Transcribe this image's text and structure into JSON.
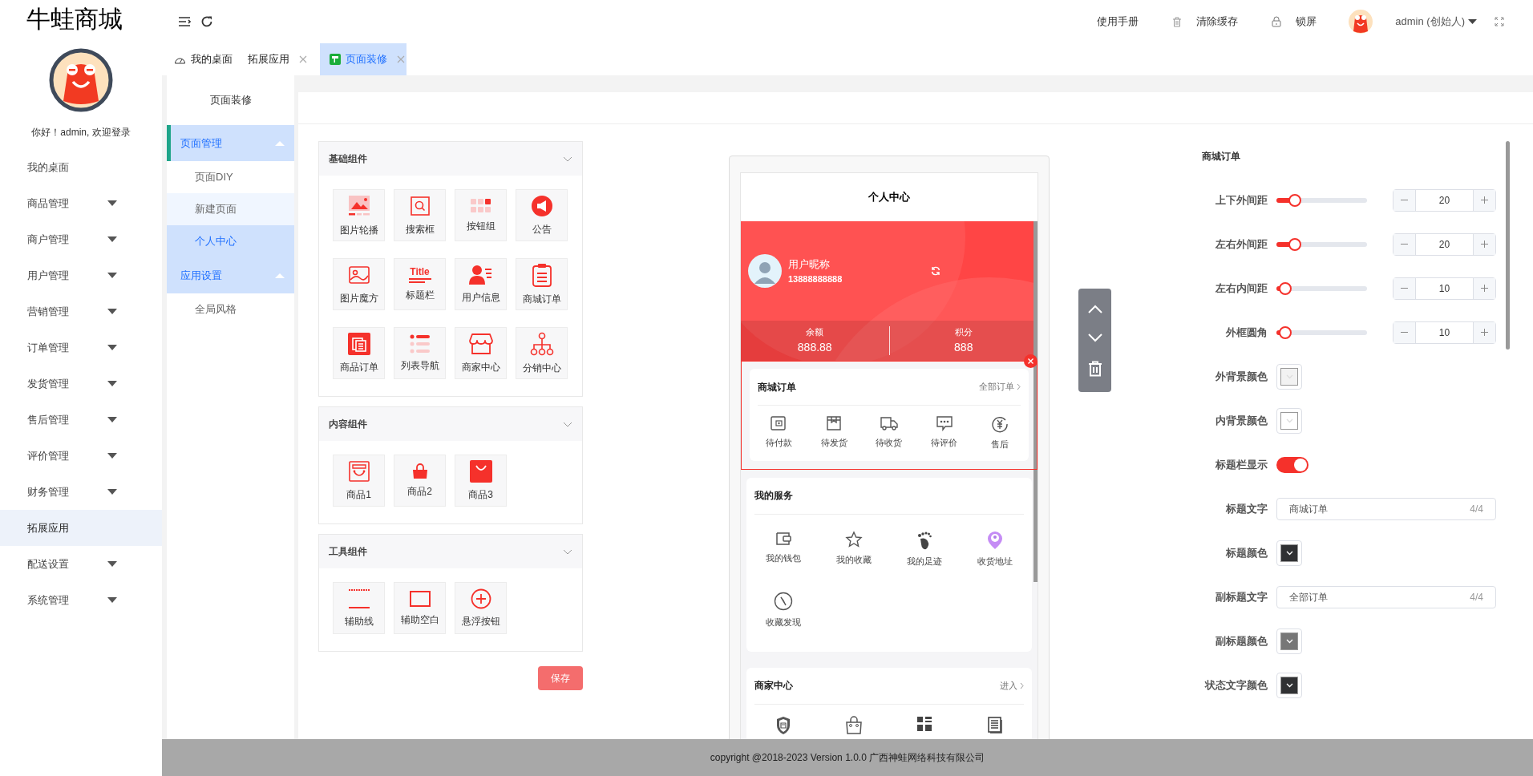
{
  "brand": "牛蛙商城",
  "greeting": "你好！admin, 欢迎登录",
  "side_menu": [
    {
      "label": "我的桌面",
      "expandable": false,
      "selected": false
    },
    {
      "label": "商品管理",
      "expandable": true,
      "selected": false
    },
    {
      "label": "商户管理",
      "expandable": true,
      "selected": false
    },
    {
      "label": "用户管理",
      "expandable": true,
      "selected": false
    },
    {
      "label": "营销管理",
      "expandable": true,
      "selected": false
    },
    {
      "label": "订单管理",
      "expandable": true,
      "selected": false
    },
    {
      "label": "发货管理",
      "expandable": true,
      "selected": false
    },
    {
      "label": "售后管理",
      "expandable": true,
      "selected": false
    },
    {
      "label": "评价管理",
      "expandable": true,
      "selected": false
    },
    {
      "label": "财务管理",
      "expandable": true,
      "selected": false
    },
    {
      "label": "拓展应用",
      "expandable": false,
      "selected": true
    },
    {
      "label": "配送设置",
      "expandable": true,
      "selected": false
    },
    {
      "label": "系统管理",
      "expandable": true,
      "selected": false
    }
  ],
  "header": {
    "actions": [
      {
        "label": "使用手册"
      },
      {
        "label": "清除缓存"
      },
      {
        "label": "锁屏"
      }
    ],
    "user": "admin (创始人)"
  },
  "tabs": [
    {
      "label": "我的桌面",
      "closable": false,
      "selected": false
    },
    {
      "label": "拓展应用",
      "closable": true,
      "selected": false
    },
    {
      "label": "页面装修",
      "closable": true,
      "selected": true
    }
  ],
  "sub_menu": {
    "title": "页面装修",
    "groups": [
      {
        "label": "页面管理",
        "expanded": true,
        "active": true,
        "children": [
          {
            "label": "页面DIY",
            "selected": false,
            "hovered": false
          },
          {
            "label": "新建页面",
            "selected": false,
            "hovered": true
          },
          {
            "label": "个人中心",
            "selected": true,
            "hovered": false
          }
        ]
      },
      {
        "label": "应用设置",
        "expanded": true,
        "active": false,
        "children": [
          {
            "label": "全局风格",
            "selected": false,
            "hovered": false
          }
        ]
      }
    ]
  },
  "component_groups": [
    {
      "title": "基础组件",
      "expanded": true,
      "items": [
        {
          "label": "图片轮播"
        },
        {
          "label": "搜索框"
        },
        {
          "label": "按钮组"
        },
        {
          "label": "公告"
        },
        {
          "label": "图片魔方"
        },
        {
          "label": "标题栏",
          "icon_text": "Title"
        },
        {
          "label": "用户信息"
        },
        {
          "label": "商城订单"
        },
        {
          "label": "商品订单"
        },
        {
          "label": "列表导航"
        },
        {
          "label": "商家中心"
        },
        {
          "label": "分销中心"
        }
      ]
    },
    {
      "title": "内容组件",
      "expanded": true,
      "items": [
        {
          "label": "商品1"
        },
        {
          "label": "商品2"
        },
        {
          "label": "商品3"
        }
      ]
    },
    {
      "title": "工具组件",
      "expanded": true,
      "items": [
        {
          "label": "辅助线"
        },
        {
          "label": "辅助空白"
        },
        {
          "label": "悬浮按钮"
        }
      ]
    }
  ],
  "save_button": "保存",
  "phone": {
    "title": "个人中心",
    "user": {
      "nickname": "用户昵称",
      "phone": "13888888888"
    },
    "stats": [
      {
        "label": "余额",
        "value": "888.88"
      },
      {
        "label": "积分",
        "value": "888"
      }
    ],
    "cards": [
      {
        "title": "商城订单",
        "more": "全部订单",
        "selected": true,
        "items": [
          "待付款",
          "待发货",
          "待收货",
          "待评价",
          "售后"
        ]
      },
      {
        "title": "我的服务",
        "selected": false,
        "items": [
          "我的钱包",
          "我的收藏",
          "我的足迹",
          "收货地址",
          "收藏发现"
        ]
      },
      {
        "title": "商家中心",
        "more": "进入",
        "selected": false
      }
    ]
  },
  "settings": {
    "title": "商城订单",
    "rows": [
      {
        "kind": "slider",
        "label": "上下外间距",
        "level": 0.2,
        "value": "20"
      },
      {
        "kind": "slider",
        "label": "左右外间距",
        "level": 0.2,
        "value": "20"
      },
      {
        "kind": "slider",
        "label": "左右内间距",
        "level": 0.1,
        "value": "10"
      },
      {
        "kind": "slider",
        "label": "外框圆角",
        "level": 0.1,
        "value": "10"
      },
      {
        "kind": "color",
        "label": "外背景颜色",
        "color": "#f2f2f2"
      },
      {
        "kind": "color",
        "label": "内背景颜色",
        "color": "#ffffff"
      },
      {
        "kind": "switch",
        "label": "标题栏显示",
        "on": true
      },
      {
        "kind": "text",
        "label": "标题文字",
        "value": "商城订单",
        "count": "4/4"
      },
      {
        "kind": "color",
        "label": "标题颜色",
        "color": "#303133"
      },
      {
        "kind": "text",
        "label": "副标题文字",
        "value": "全部订单",
        "count": "4/4"
      },
      {
        "kind": "color",
        "label": "副标题颜色",
        "color": "#777777"
      },
      {
        "kind": "color",
        "label": "状态文字颜色",
        "color": "#303133"
      }
    ]
  },
  "footer": "copyright @2018-2023 Version 1.0.0 广西神蛙网络科技有限公司"
}
